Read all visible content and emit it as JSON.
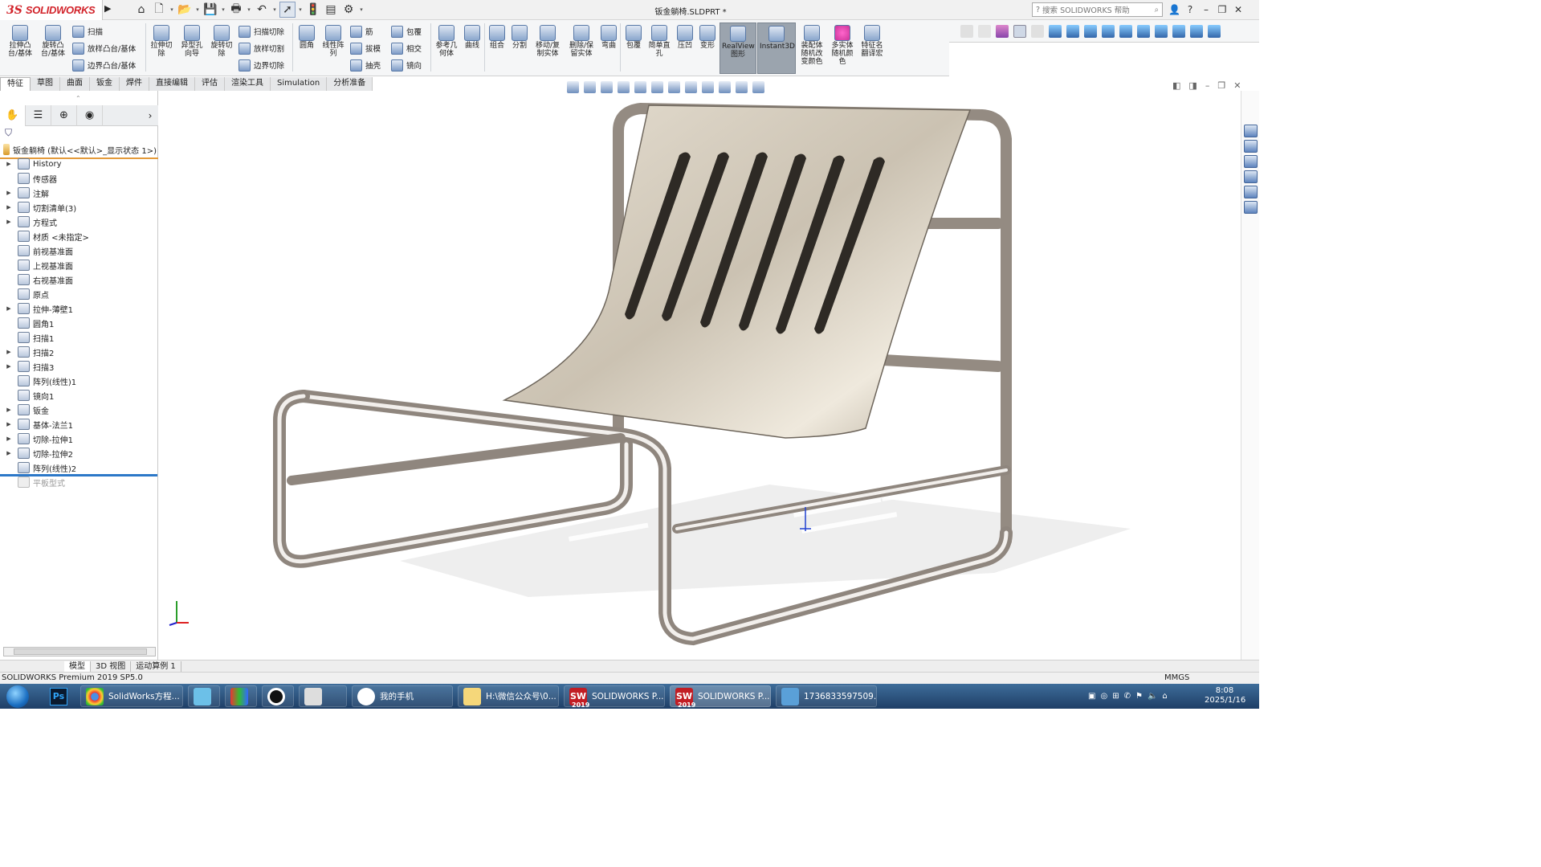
{
  "app": {
    "logo_ds": "3S",
    "logo_name": "SOLIDWORKS",
    "document_title": "钣金躺椅.SLDPRT *"
  },
  "search": {
    "placeholder": "搜索 SOLIDWORKS 帮助",
    "icon": "search-icon"
  },
  "ribbon": {
    "tools": [
      {
        "label": "拉伸凸\n台/基体",
        "icon": "extrude-boss-icon"
      },
      {
        "label": "旋转凸\n台/基体",
        "icon": "revolve-boss-icon"
      },
      {
        "label": "拉伸切\n除",
        "icon": "extrude-cut-icon"
      },
      {
        "label": "异型孔\n向导",
        "icon": "hole-wizard-icon"
      },
      {
        "label": "旋转切\n除",
        "icon": "revolve-cut-icon"
      },
      {
        "label": "圆角",
        "icon": "fillet-icon"
      },
      {
        "label": "线性阵\n列",
        "icon": "linear-pattern-icon"
      },
      {
        "label": "参考几\n何体",
        "icon": "reference-geometry-icon"
      },
      {
        "label": "曲线",
        "icon": "curves-icon"
      },
      {
        "label": "组合",
        "icon": "combine-icon"
      },
      {
        "label": "分割",
        "icon": "split-icon"
      },
      {
        "label": "移动/复\n制实体",
        "icon": "move-copy-body-icon"
      },
      {
        "label": "删除/保\n留实体",
        "icon": "delete-keep-body-icon"
      },
      {
        "label": "弯曲",
        "icon": "flex-icon"
      },
      {
        "label": "包覆",
        "icon": "wrap-icon"
      },
      {
        "label": "简单直\n孔",
        "icon": "simple-hole-icon"
      },
      {
        "label": "压凹",
        "icon": "indent-icon"
      },
      {
        "label": "变形",
        "icon": "deform-icon"
      },
      {
        "label": "RealView\n图形",
        "icon": "realview-icon"
      },
      {
        "label": "Instant3D",
        "icon": "instant3d-icon"
      },
      {
        "label": "装配体\n随机改\n变颜色",
        "icon": "random-color-icon"
      },
      {
        "label": "多实体\n随机颜\n色",
        "icon": "multibody-color-icon"
      },
      {
        "label": "特征名\n翻译宏",
        "icon": "macro-icon"
      }
    ],
    "small_tools": [
      {
        "label": "扫描",
        "icon": "sweep-icon"
      },
      {
        "label": "放样凸台/基体",
        "icon": "loft-icon"
      },
      {
        "label": "边界凸台/基体",
        "icon": "boundary-boss-icon"
      },
      {
        "label": "扫描切除",
        "icon": "swept-cut-icon"
      },
      {
        "label": "放样切割",
        "icon": "lofted-cut-icon"
      },
      {
        "label": "边界切除",
        "icon": "boundary-cut-icon"
      },
      {
        "label": "筋",
        "icon": "rib-icon"
      },
      {
        "label": "拔模",
        "icon": "draft-icon"
      },
      {
        "label": "抽壳",
        "icon": "shell-icon"
      },
      {
        "label": "包覆",
        "icon": "wrap-icon"
      },
      {
        "label": "相交",
        "icon": "intersect-icon"
      },
      {
        "label": "镜向",
        "icon": "mirror-icon"
      }
    ]
  },
  "tabs": [
    "特征",
    "草图",
    "曲面",
    "钣金",
    "焊件",
    "直接编辑",
    "评估",
    "渲染工具",
    "Simulation",
    "分析准备"
  ],
  "active_tab": "特征",
  "tree": {
    "root": "钣金躺椅  (默认<<默认>_显示状态 1>)",
    "items": [
      {
        "label": "History",
        "expand": true
      },
      {
        "label": "传感器",
        "expand": false
      },
      {
        "label": "注解",
        "expand": true
      },
      {
        "label": "切割清单(3)",
        "expand": true
      },
      {
        "label": "方程式",
        "expand": true
      },
      {
        "label": "材质 <未指定>",
        "expand": false
      },
      {
        "label": "前视基准面",
        "expand": false
      },
      {
        "label": "上视基准面",
        "expand": false
      },
      {
        "label": "右视基准面",
        "expand": false
      },
      {
        "label": "原点",
        "expand": false
      },
      {
        "label": "拉伸-薄壁1",
        "expand": true
      },
      {
        "label": "圆角1",
        "expand": false
      },
      {
        "label": "扫描1",
        "expand": false
      },
      {
        "label": "扫描2",
        "expand": true
      },
      {
        "label": "扫描3",
        "expand": true
      },
      {
        "label": "阵列(线性)1",
        "expand": false
      },
      {
        "label": "镜向1",
        "expand": false
      },
      {
        "label": "钣金",
        "expand": true
      },
      {
        "label": "基体-法兰1",
        "expand": true
      },
      {
        "label": "切除-拉伸1",
        "expand": true
      },
      {
        "label": "切除-拉伸2",
        "expand": true
      },
      {
        "label": "阵列(线性)2",
        "expand": false
      },
      {
        "label": "平板型式",
        "expand": false,
        "dimmed": true
      }
    ]
  },
  "model_tabs": [
    "模型",
    "3D 视图",
    "运动算例 1"
  ],
  "status": {
    "product": "SOLIDWORKS Premium 2019 SP5.0",
    "units": "MMGS"
  },
  "taskbar": {
    "items": [
      {
        "label": "SolidWorks方程...",
        "icon": "chrome-icon"
      },
      {
        "label": "",
        "icon": "app-icon"
      },
      {
        "label": "",
        "icon": "color-app-icon"
      },
      {
        "label": "",
        "icon": "record-icon"
      },
      {
        "label": "",
        "icon": "paint-icon"
      },
      {
        "label": "我的手机",
        "icon": "qq-icon"
      },
      {
        "label": "H:\\微信公众号\\0...",
        "icon": "folder-icon"
      },
      {
        "label": "SOLIDWORKS P...",
        "icon": "solidworks-icon"
      },
      {
        "label": "SOLIDWORKS P...",
        "icon": "solidworks-icon"
      },
      {
        "label": "1736833597509...",
        "icon": "image-viewer-icon"
      }
    ],
    "ps_label": "Ps",
    "sw_badge": "2019",
    "sw_label": "SW",
    "time": "8:08",
    "date": "2025/1/16"
  }
}
